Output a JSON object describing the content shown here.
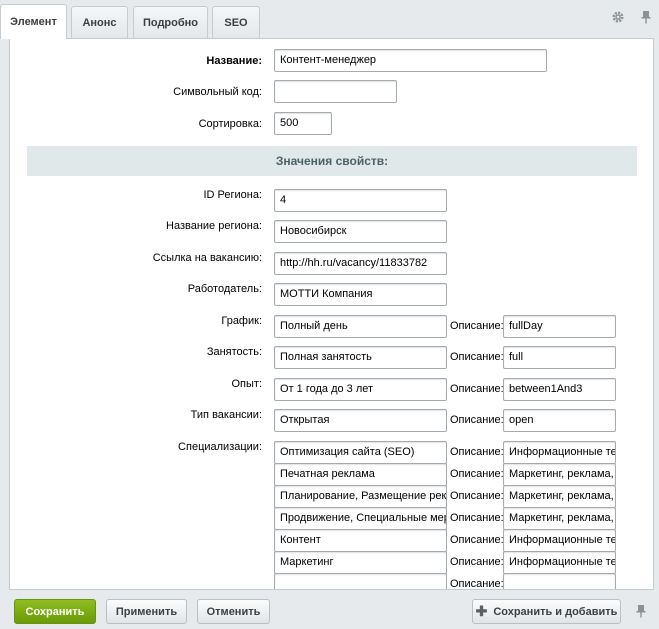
{
  "tabs": [
    {
      "label": "Элемент",
      "active": true
    },
    {
      "label": "Анонс",
      "active": false
    },
    {
      "label": "Подробно",
      "active": false
    },
    {
      "label": "SEO",
      "active": false
    }
  ],
  "tab_icons": [
    "gear-icon",
    "pin-icon"
  ],
  "fields": {
    "name": {
      "label": "Название:",
      "value": "Контент-менеджер"
    },
    "code": {
      "label": "Символьный код:",
      "value": ""
    },
    "sort": {
      "label": "Сортировка:",
      "value": "500"
    }
  },
  "section_title": "Значения свойств:",
  "props": {
    "region_id": {
      "label": "ID Региона:",
      "value": "4"
    },
    "region_name": {
      "label": "Название региона:",
      "value": "Новосибирск"
    },
    "vacancy_link": {
      "label": "Ссылка на вакансию:",
      "value": "http://hh.ru/vacancy/11833782"
    },
    "employer": {
      "label": "Работодатель:",
      "value": "МОТТИ Компания"
    },
    "schedule": {
      "label": "График:",
      "value": "Полный день",
      "desc": "fullDay"
    },
    "employment": {
      "label": "Занятость:",
      "value": "Полная занятость",
      "desc": "full"
    },
    "experience": {
      "label": "Опыт:",
      "value": "От 1 года до 3 лет",
      "desc": "between1And3"
    },
    "vacancy_type": {
      "label": "Тип вакансии:",
      "value": "Открытая",
      "desc": "open"
    }
  },
  "desc_label": "Описание:",
  "specializations": {
    "label": "Специализации:",
    "items": [
      {
        "value": "Оптимизация сайта (SEO)",
        "desc": "Информационные те"
      },
      {
        "value": "Печатная реклама",
        "desc": "Маркетинг, реклама,"
      },
      {
        "value": "Планирование, Размещение рек",
        "desc": "Маркетинг, реклама,"
      },
      {
        "value": "Продвижение, Специальные мер",
        "desc": "Маркетинг, реклама,"
      },
      {
        "value": "Контент",
        "desc": "Информационные те"
      },
      {
        "value": "Маркетинг",
        "desc": "Информационные те"
      },
      {
        "value": "",
        "desc": ""
      }
    ]
  },
  "buttons": {
    "save": "Сохранить",
    "apply": "Применить",
    "cancel": "Отменить",
    "save_add": "Сохранить и добавить"
  }
}
